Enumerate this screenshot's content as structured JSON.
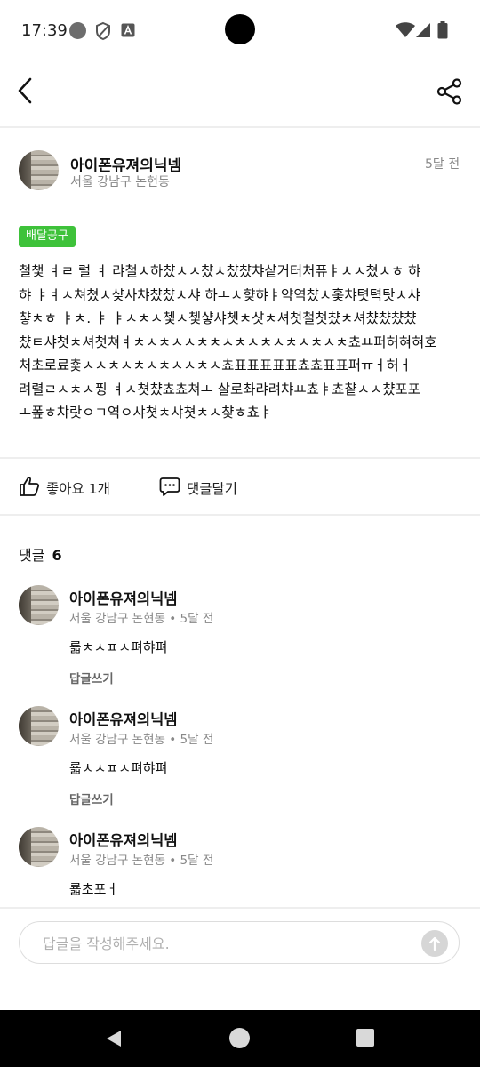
{
  "status_bar": {
    "time": "17:39"
  },
  "post": {
    "author": "아이폰유져의닉넴",
    "location": "서울 강남구 논현동",
    "time": "5달 전",
    "category_badge": "배달공구",
    "body_lines": [
      "철챛 ㅕㄹ 럴 ㅕ 랴철ㅊ하챴ㅊㅅ챴ㅊ챴챴챠샽거터처퓨ㅑㅊㅅ쳤ㅊㅎ 햐",
      "햐 ㅑㅕㅅ쳐쳤ㅊ샺사챠챴챴ㅊ샤 하ㅗㅊ햦햐ㅑ약역챴ㅊ홏챠텻텩탓ㅊ샤",
      "챻ㅊㅎ ㅑㅊ. ㅑ ㅑㅅㅊㅅ쳋ㅅ쳋샿샤쳇ㅊ샷ㅊ셔쳣철쳣챴ㅊ셔챴챴챴챴",
      "챴ㅌ샤쳣ㅊ셔쳣쳐ㅕㅊㅅㅊㅅㅅㅊㅊㅅㅊㅅㅊㅅㅊㅅㅊㅅㅊ쵸ㅛ퍼허혀혀호",
      "처초로료춏ㅅㅅㅊㅅㅊㅅㅊㅅㅅㅊㅅ쵸표표표표표쵸쵸표표퍼ㅠㅓ허ㅓ",
      "려렬ㄹㅅㅊㅅ퓡 ㅕㅅ쳣챴쵸쵸쳐ㅗ 살로촤랴려챠ㅛ쵸ㅑ쵸챹ㅅㅅ챴포포",
      "ㅗ퐆ㅎ챠랏ㅇㄱ역ㅇ샤쳣ㅊ샤쳣ㅊㅅ챶ㅎ쵸ㅑ"
    ]
  },
  "actions": {
    "like_label": "좋아요 1개",
    "comment_label": "댓글달기"
  },
  "comments_header": {
    "title": "댓글",
    "count": "6"
  },
  "comments": [
    {
      "author": "아이폰유져의닉넴",
      "location": "서울 강남구 논현동",
      "separator": "•",
      "time": "5달 전",
      "text": "룗ㅊㅅㅍㅅ펴햐펴",
      "reply_label": "답글쓰기"
    },
    {
      "author": "아이폰유져의닉넴",
      "location": "서울 강남구 논현동",
      "separator": "•",
      "time": "5달 전",
      "text": "룗ㅊㅅㅍㅅ펴햐펴",
      "reply_label": "답글쓰기"
    },
    {
      "author": "아이폰유져의닉넴",
      "location": "서울 강남구 논현동",
      "separator": "•",
      "time": "5달 전",
      "text": "룗초포ㅓ",
      "reply_label": ""
    }
  ],
  "reply_input": {
    "placeholder": "답글을 작성해주세요.",
    "value": ""
  },
  "colors": {
    "badge": "#3ec23a",
    "divider": "#eeeeee",
    "muted": "#888888"
  },
  "icons": [
    "back-arrow-icon",
    "share-icon",
    "thumbs-up-icon",
    "chat-bubble-icon",
    "arrow-up-icon"
  ]
}
